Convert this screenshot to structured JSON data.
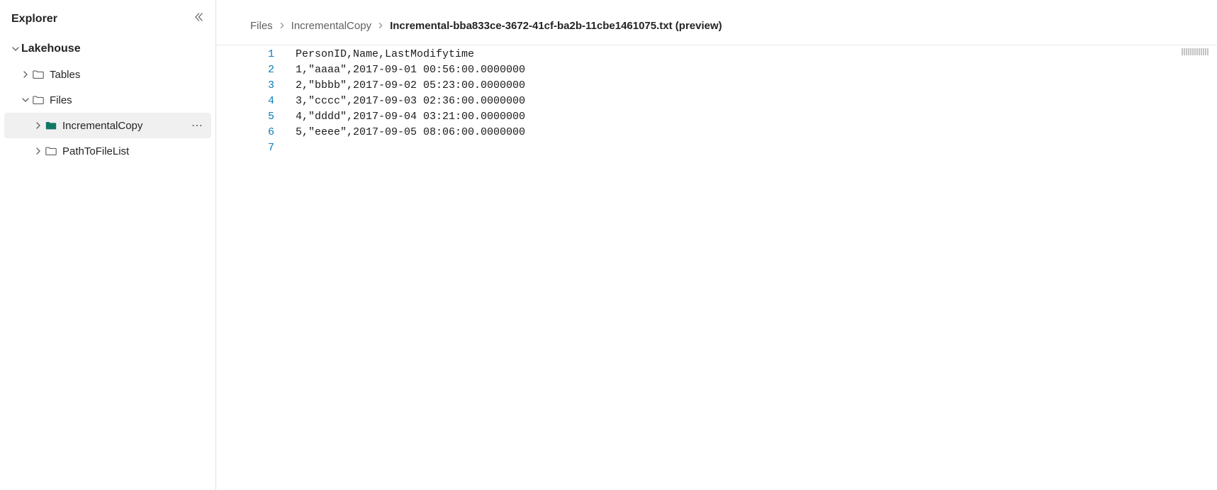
{
  "sidebar": {
    "title": "Explorer",
    "root": {
      "label": "Lakehouse"
    },
    "items": [
      {
        "label": "Tables",
        "chev": "closed",
        "icon": "folder"
      },
      {
        "label": "Files",
        "chev": "open",
        "icon": "folder"
      },
      {
        "label": "IncrementalCopy",
        "chev": "closed",
        "icon": "folder-solid",
        "selected": true
      },
      {
        "label": "PathToFileList",
        "chev": "closed",
        "icon": "folder"
      }
    ]
  },
  "breadcrumb": {
    "items": [
      {
        "label": "Files"
      },
      {
        "label": "IncrementalCopy"
      },
      {
        "label": "Incremental-bba833ce-3672-41cf-ba2b-11cbe1461075.txt (preview)",
        "active": true
      }
    ]
  },
  "file": {
    "lines": [
      "PersonID,Name,LastModifytime",
      "1,\"aaaa\",2017-09-01 00:56:00.0000000",
      "2,\"bbbb\",2017-09-02 05:23:00.0000000",
      "3,\"cccc\",2017-09-03 02:36:00.0000000",
      "4,\"dddd\",2017-09-04 03:21:00.0000000",
      "5,\"eeee\",2017-09-05 08:06:00.0000000",
      ""
    ]
  }
}
